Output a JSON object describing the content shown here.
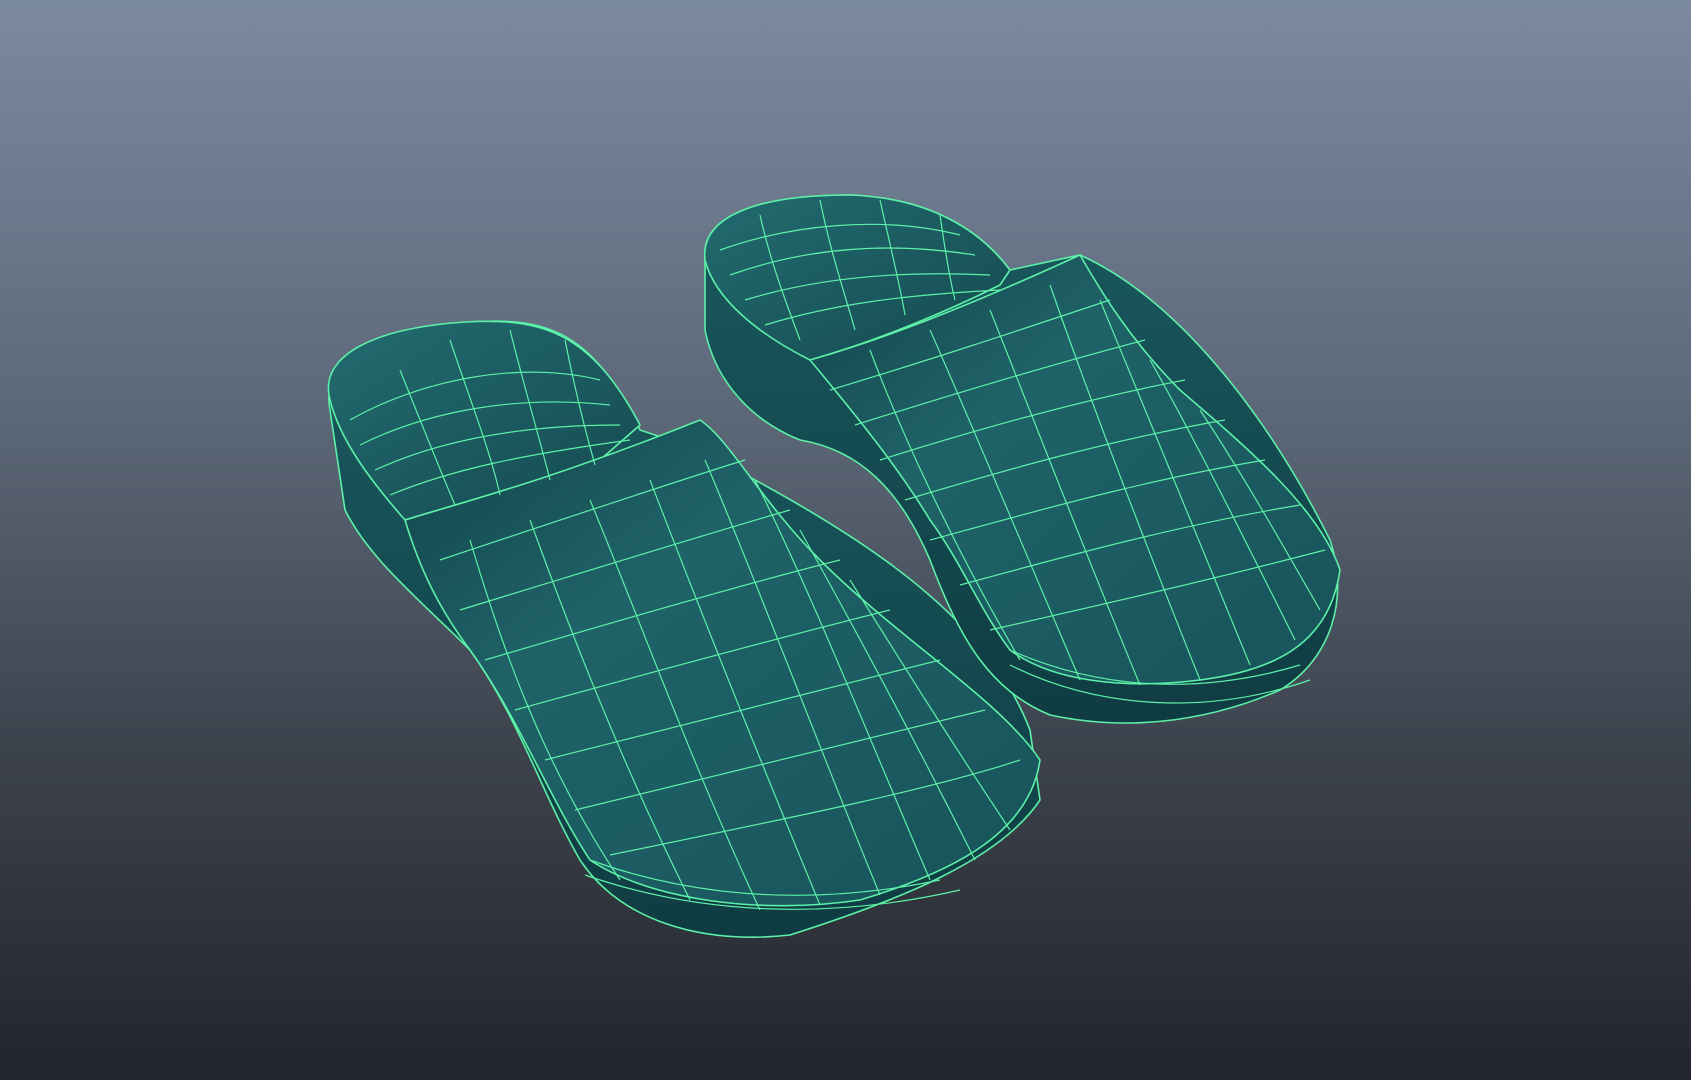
{
  "viewport": {
    "background_top": "#7b8aa0",
    "background_bottom": "#22252b"
  },
  "scene": {
    "objects": [
      {
        "name": "left-clog",
        "type": "polygon-mesh"
      },
      {
        "name": "right-clog",
        "type": "polygon-mesh"
      }
    ],
    "display_mode": "smooth-shade-with-wireframe",
    "mesh_color": "#1d5c62",
    "wire_color": "#5cf0a8"
  }
}
